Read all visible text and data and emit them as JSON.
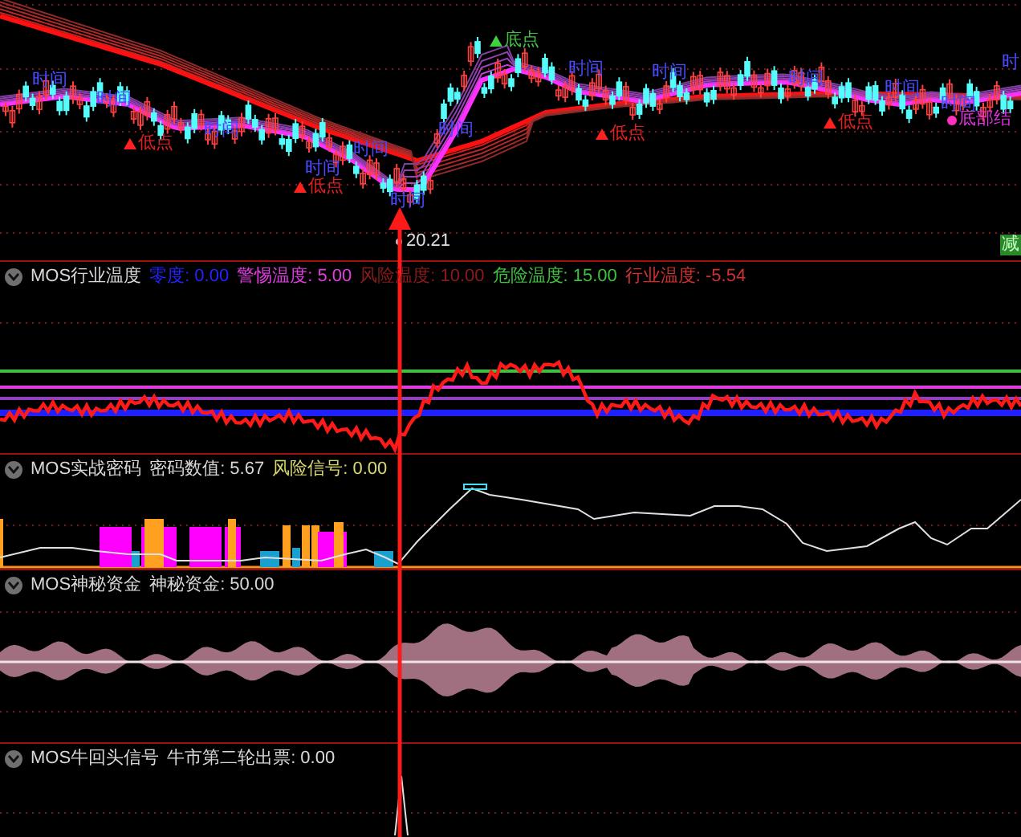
{
  "price_panel": {
    "annotations": [
      {
        "kind": "time",
        "text": "时间"
      },
      {
        "kind": "time",
        "text": "时间"
      },
      {
        "kind": "low",
        "text": "低点"
      },
      {
        "kind": "time",
        "text": "时间"
      },
      {
        "kind": "time",
        "text": "时间"
      },
      {
        "kind": "low",
        "text": "低点"
      },
      {
        "kind": "time",
        "text": "时间"
      },
      {
        "kind": "time",
        "text": "时间"
      },
      {
        "kind": "time",
        "text": "时间"
      },
      {
        "kind": "top",
        "text": "底点"
      },
      {
        "kind": "time",
        "text": "时间"
      },
      {
        "kind": "low",
        "text": "低点"
      },
      {
        "kind": "time",
        "text": "时间"
      },
      {
        "kind": "time",
        "text": "时间"
      },
      {
        "kind": "low",
        "text": "低点"
      },
      {
        "kind": "time",
        "text": "时间"
      },
      {
        "kind": "time",
        "text": "时间"
      },
      {
        "kind": "bottom",
        "text": "底部结"
      },
      {
        "kind": "time",
        "text": "时"
      }
    ],
    "low_price": "20.21",
    "badge": "减"
  },
  "indicators": [
    {
      "kind": "temperature",
      "title": "MOS行业温度",
      "readings": [
        {
          "label": "零度:",
          "value": "0.00",
          "color": "#2323ff"
        },
        {
          "label": "警惕温度:",
          "value": "5.00",
          "color": "#e03ce0"
        },
        {
          "label": "风险温度:",
          "value": "10.00",
          "color": "#8b1a1a"
        },
        {
          "label": "危险温度:",
          "value": "15.00",
          "color": "#40c040"
        },
        {
          "label": "行业温度:",
          "value": "-5.54",
          "color": "#d03030"
        }
      ]
    },
    {
      "kind": "code",
      "title": "MOS实战密码",
      "readings": [
        {
          "label": "密码数值:",
          "value": "5.67",
          "color": "#d8d8d8"
        },
        {
          "label": "风险信号:",
          "value": "0.00",
          "color": "#d8d870"
        }
      ]
    },
    {
      "kind": "fund",
      "title": "MOS神秘资金",
      "readings": [
        {
          "label": "神秘资金:",
          "value": "50.00",
          "color": "#d8d8d8"
        }
      ]
    },
    {
      "kind": "bull",
      "title": "MOS牛回头信号",
      "readings": [
        {
          "label": "牛市第二轮出票:",
          "value": "0.00",
          "color": "#d8d8d8"
        }
      ]
    }
  ]
}
